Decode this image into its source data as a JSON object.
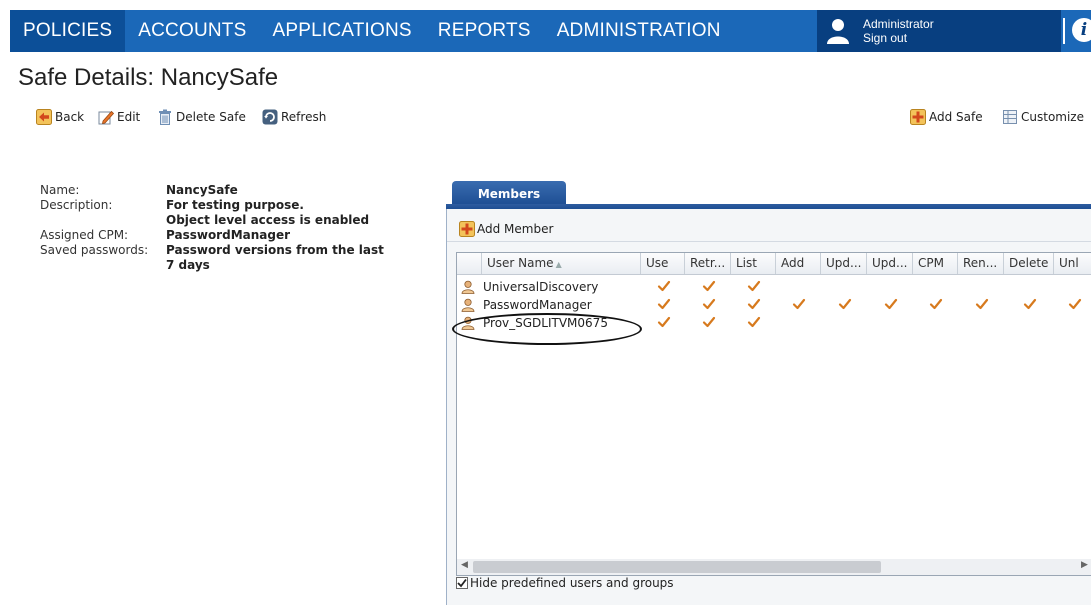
{
  "nav": {
    "items": [
      "POLICIES",
      "ACCOUNTS",
      "APPLICATIONS",
      "REPORTS",
      "ADMINISTRATION"
    ],
    "active": "POLICIES",
    "user_name": "Administrator",
    "sign_out": "Sign out",
    "info_symbol": "i"
  },
  "page": {
    "title": "Safe Details: NancySafe"
  },
  "toolbar": {
    "back": "Back",
    "edit": "Edit",
    "delete_safe": "Delete Safe",
    "refresh": "Refresh",
    "add_safe": "Add Safe",
    "customize": "Customize"
  },
  "details": {
    "name_label": "Name:",
    "name_value": "NancySafe",
    "description_label": "Description:",
    "description_value": "For testing purpose.",
    "object_level_note": "Object level access is enabled",
    "cpm_label": "Assigned CPM:",
    "cpm_value": "PasswordManager",
    "saved_label": "Saved passwords:",
    "saved_value_line1": "Password versions from the last",
    "saved_value_line2": "7 days"
  },
  "members": {
    "tab_label": "Members",
    "add_member": "Add Member",
    "columns": [
      "User Name",
      "Use",
      "Retr...",
      "List",
      "Add",
      "Upd...",
      "Upd...",
      "CPM",
      "Ren...",
      "Delete",
      "Unl"
    ],
    "sorted_column": "User Name",
    "rows": [
      {
        "user": "UniversalDiscovery",
        "checks": [
          true,
          true,
          true,
          false,
          false,
          false,
          false,
          false,
          false,
          false
        ]
      },
      {
        "user": "PasswordManager",
        "checks": [
          true,
          true,
          true,
          true,
          true,
          true,
          true,
          true,
          true,
          true
        ]
      },
      {
        "user": "Prov_SGDLITVM0675",
        "checks": [
          true,
          true,
          true,
          false,
          false,
          false,
          false,
          false,
          false,
          false
        ]
      }
    ],
    "highlighted_row": "Prov_SGDLITVM0675",
    "hide_predefined_label": "Hide predefined users and groups",
    "hide_predefined_checked": true
  },
  "colors": {
    "nav_bg": "#1b68b8",
    "nav_active": "#0c4f98",
    "user_box": "#083f80",
    "tab_bg": "#1d4e93",
    "check": "#d77a1e"
  },
  "icons": {
    "back": "back-arrow-icon",
    "edit": "pencil-icon",
    "delete": "trash-icon",
    "refresh": "refresh-icon",
    "add_safe": "add-safe-icon",
    "customize": "customize-grid-icon",
    "member": "user-icon",
    "check": "checkmark-icon"
  }
}
